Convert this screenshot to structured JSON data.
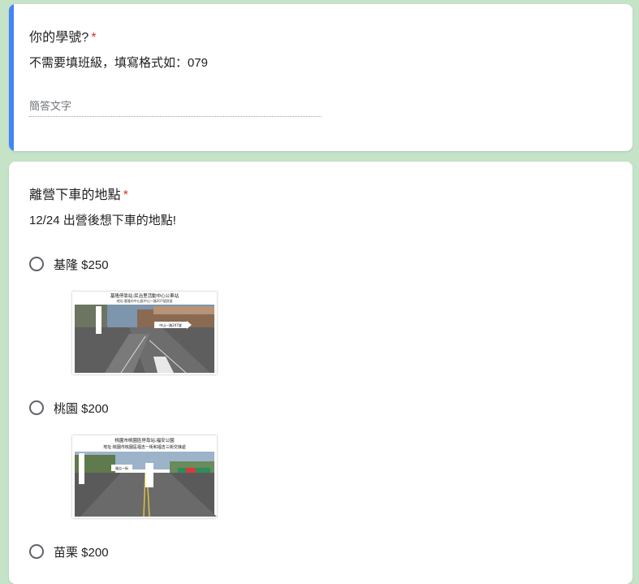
{
  "question1": {
    "title": "你的學號?",
    "required_mark": "*",
    "description": "不需要填班級，填寫格式如：079",
    "placeholder": "簡答文字"
  },
  "question2": {
    "title": "離營下車的地點",
    "required_mark": "*",
    "description": "12/24 出營後想下車的地點!",
    "options": [
      {
        "label": "基隆 $250",
        "image_caption": "基隆停靠站:民治里活動中心公車站",
        "image_subcaption": "地址:基隆市中山區中山一路207號對面",
        "image_sign": "中山一路207號"
      },
      {
        "label": "桃園 $200",
        "image_caption": "桃園市桃園區停靠站:福安公園",
        "image_subcaption": "地址:桃園市桃園區福吉一街和福吉三街交接處",
        "image_sign": "福吉一街"
      },
      {
        "label": "苗栗 $200"
      }
    ]
  },
  "colors": {
    "background": "#c5e3c6",
    "accent": "#4285f4",
    "required": "#d93025"
  }
}
